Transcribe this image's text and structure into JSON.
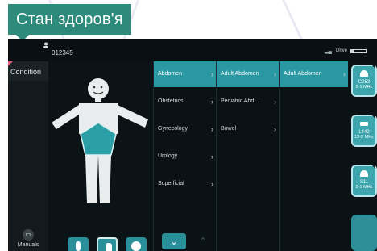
{
  "caption": "Стан здоров'я",
  "header": {
    "patient_id": "012345",
    "drive_label": "Drive",
    "drive_level": 0.15
  },
  "sidebar": {
    "condition_label": "Condition",
    "manuals_label": "Manuals"
  },
  "categories": [
    "Abdomen",
    "Obstetrics",
    "Gynecology",
    "Urology",
    "Superficial"
  ],
  "subcategories": [
    "Adult Abdomen",
    "Pediatric Abd...",
    "Bowel"
  ],
  "presets": [
    "Adult Abdomen"
  ],
  "probes": [
    {
      "name": "C253",
      "freq": "2-1 MHz"
    },
    {
      "name": "L442",
      "freq": "12-2 MHz"
    },
    {
      "name": "S11",
      "freq": "2-1 MHz"
    }
  ],
  "colors": {
    "accent": "#2a98a2",
    "caption_bg": "#2e8b7b",
    "background": "#0a0f13"
  }
}
